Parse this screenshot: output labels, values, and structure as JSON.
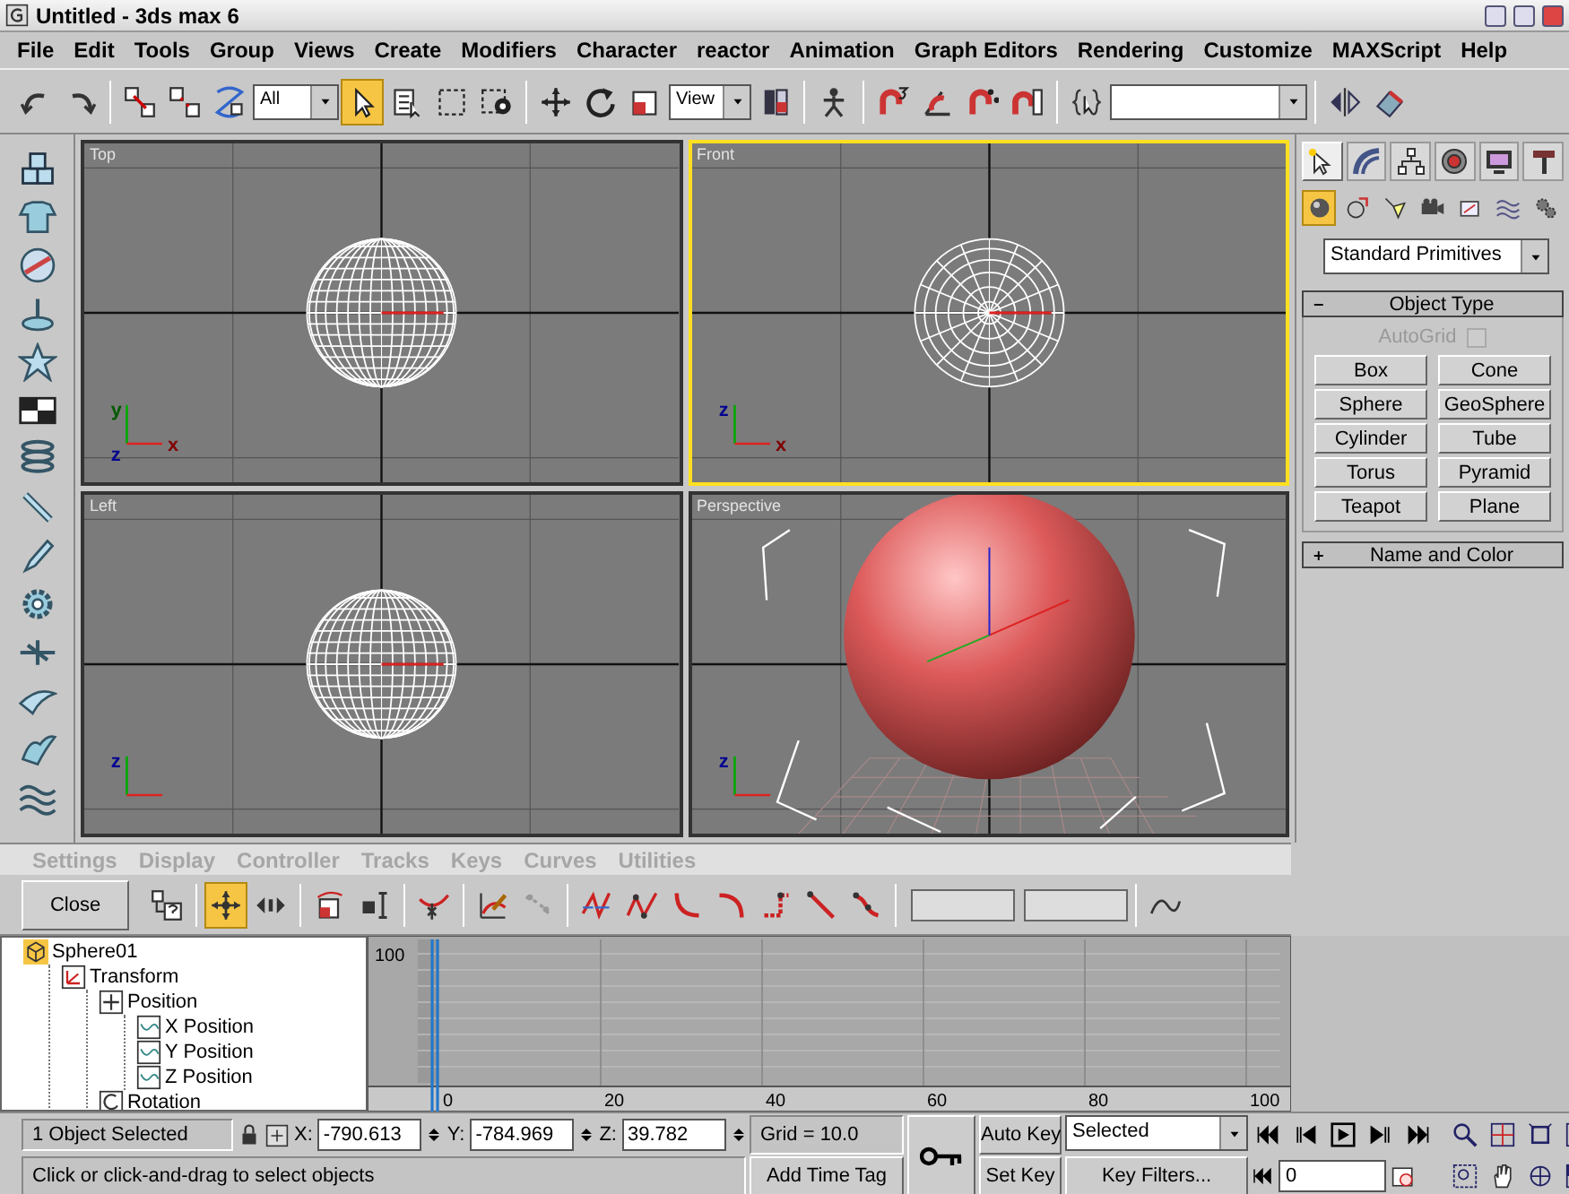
{
  "window": {
    "title": "Untitled - 3ds max 6"
  },
  "menu": [
    "File",
    "Edit",
    "Tools",
    "Group",
    "Views",
    "Create",
    "Modifiers",
    "Character",
    "reactor",
    "Animation",
    "Graph Editors",
    "Rendering",
    "Customize",
    "MAXScript",
    "Help"
  ],
  "toolbar": {
    "tools": [
      {
        "selected": false
      },
      {
        "selected": false
      },
      {
        "selected": false
      },
      {
        "selected": false
      },
      {
        "selected": false
      },
      {
        "selected": true
      },
      {
        "selected": false
      },
      {
        "selected": false
      },
      {
        "selected": false
      },
      {
        "selected": false
      },
      {
        "selected": false
      },
      {
        "selected": false
      },
      {
        "selected": false
      },
      {
        "selected": false
      },
      {
        "selected": false
      },
      {
        "selected": false
      },
      {
        "selected": false
      },
      {
        "selected": false
      },
      {
        "selected": false
      },
      {
        "selected": false
      },
      {
        "selected": false
      }
    ],
    "dropdowns": [
      "All",
      "View"
    ]
  },
  "viewports": [
    {
      "label": "Top",
      "selected": false,
      "kind": "wireframe",
      "tripod": {
        "up": {
          "label": "y",
          "color": "#005800"
        },
        "origin": {
          "label": "z",
          "color": "#000090"
        },
        "right": {
          "label": "x",
          "color": "#800000"
        }
      }
    },
    {
      "label": "Front",
      "selected": true,
      "kind": "polar",
      "tripod": {
        "up": {
          "label": "z",
          "color": "#000090"
        },
        "right": {
          "label": "x",
          "color": "#800000"
        }
      }
    },
    {
      "label": "Left",
      "selected": false,
      "kind": "wireframe",
      "tripod": {
        "up": {
          "label": "z",
          "color": "#000090"
        }
      }
    },
    {
      "label": "Perspective",
      "selected": false,
      "kind": "shaded",
      "tripod": {
        "up": {
          "label": "z",
          "color": "#000090"
        }
      }
    }
  ],
  "command_panel": {
    "tabs": [
      {
        "selected": true
      },
      {
        "selected": false
      },
      {
        "selected": false
      },
      {
        "selected": false
      },
      {
        "selected": false
      },
      {
        "selected": false
      }
    ],
    "categories": [
      {
        "selected": true
      },
      {
        "selected": false
      },
      {
        "selected": false
      },
      {
        "selected": false
      },
      {
        "selected": false
      },
      {
        "selected": false
      },
      {
        "selected": false
      }
    ],
    "dropdown": "Standard Primitives",
    "rollouts": [
      {
        "title": "Object Type",
        "expanded": true,
        "autogrid": {
          "label": "AutoGrid",
          "checked": false,
          "disabled": true
        },
        "buttons": [
          "Box",
          "Cone",
          "Sphere",
          "GeoSphere",
          "Cylinder",
          "Tube",
          "Torus",
          "Pyramid",
          "Teapot",
          "Plane"
        ]
      },
      {
        "title": "Name and Color",
        "expanded": false
      }
    ]
  },
  "track_view": {
    "menu": [
      {
        "label": "Settings",
        "disabled": true
      },
      {
        "label": "Display",
        "disabled": true
      },
      {
        "label": "Controller",
        "disabled": true
      },
      {
        "label": "Tracks",
        "disabled": true
      },
      {
        "label": "Keys",
        "disabled": true
      },
      {
        "label": "Curves",
        "disabled": true
      },
      {
        "label": "Utilities",
        "disabled": true
      }
    ],
    "close_button": "Close",
    "tools": [
      {
        "selected": false
      },
      {
        "selected": true
      },
      {
        "selected": false
      },
      {
        "selected": false
      },
      {
        "selected": false
      },
      {
        "selected": false
      },
      {
        "selected": false
      },
      {
        "selected": false
      },
      {
        "selected": false
      },
      {
        "selected": false
      },
      {
        "selected": false
      },
      {
        "selected": false
      },
      {
        "selected": false
      },
      {
        "selected": false
      },
      {
        "selected": false
      }
    ],
    "tree": [
      {
        "label": "Sphere01",
        "kind": "object",
        "children": [
          {
            "label": "Transform",
            "kind": "transform",
            "children": [
              {
                "label": "Position",
                "kind": "position",
                "children": [
                  {
                    "label": "X Position",
                    "kind": "float"
                  },
                  {
                    "label": "Y Position",
                    "kind": "float"
                  },
                  {
                    "label": "Z Position",
                    "kind": "float"
                  }
                ]
              },
              {
                "label": "Rotation",
                "kind": "rotation"
              }
            ]
          }
        ]
      }
    ],
    "value_label": "100",
    "ruler": [
      "0",
      "20",
      "40",
      "60",
      "80",
      "100"
    ]
  },
  "status_bar": {
    "selection": "1 Object Selected",
    "coords": [
      {
        "axis": "X:",
        "value": "-790.613"
      },
      {
        "axis": "Y:",
        "value": "-784.969"
      },
      {
        "axis": "Z:",
        "value": "39.782"
      }
    ],
    "grid": "Grid = 10.0",
    "prompt": "Click or click-and-drag to select objects",
    "add_time_tag": "Add Time Tag",
    "auto_key": {
      "label": "Auto Key",
      "on": false
    },
    "key_mode": "Selected",
    "set_key": "Set Key",
    "key_filters": "Key Filters...",
    "frame": "0"
  }
}
